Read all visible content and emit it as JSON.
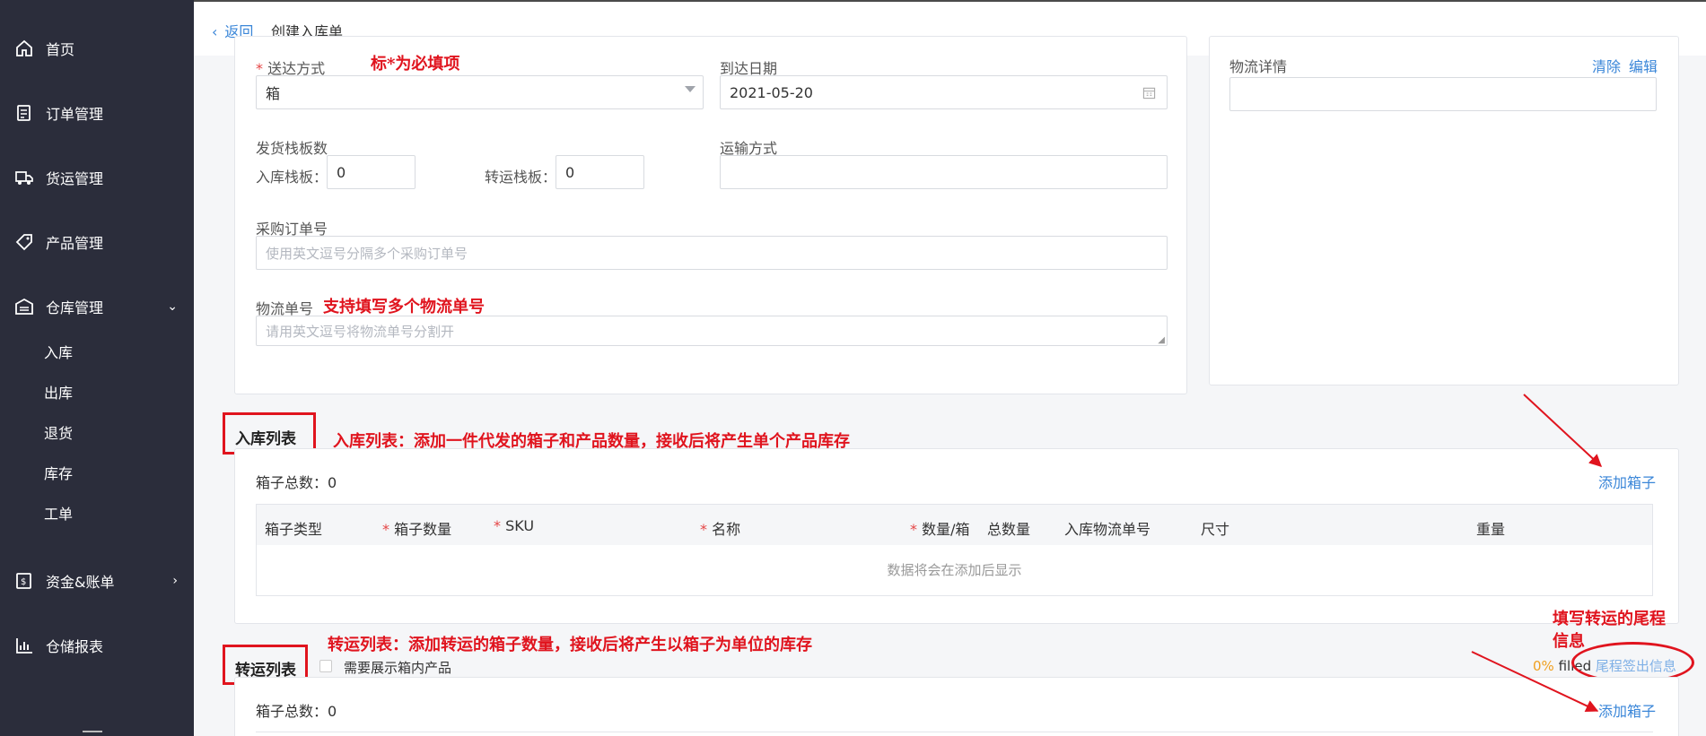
{
  "sidebar": {
    "items": [
      {
        "label": "首页",
        "icon": "home-icon"
      },
      {
        "label": "订单管理",
        "icon": "order-icon"
      },
      {
        "label": "货运管理",
        "icon": "truck-icon"
      },
      {
        "label": "产品管理",
        "icon": "tag-icon"
      },
      {
        "label": "仓库管理",
        "icon": "warehouse-icon"
      },
      {
        "label": "资金&账单",
        "icon": "bill-icon"
      },
      {
        "label": "仓储报表",
        "icon": "chart-icon"
      }
    ],
    "subitems": [
      "入库",
      "出库",
      "退货",
      "库存",
      "工单"
    ]
  },
  "header": {
    "back": "返回",
    "title": "创建入库单"
  },
  "form": {
    "delivery_label": "送达方式",
    "delivery_value": "箱",
    "arrival_label": "到达日期",
    "arrival_value": "2021-05-20",
    "pallet_label": "发货栈板数",
    "inbound_pallet_label": "入库栈板：",
    "inbound_pallet_value": "0",
    "transfer_pallet_label": "转运栈板：",
    "transfer_pallet_value": "0",
    "transport_label": "运输方式",
    "po_label": "采购订单号",
    "po_placeholder": "使用英文逗号分隔多个采购订单号",
    "tracking_label": "物流单号",
    "tracking_placeholder": "请用英文逗号将物流单号分割开"
  },
  "logistics": {
    "label": "物流详情",
    "clear": "清除",
    "edit": "编辑"
  },
  "annotations": {
    "required": "标*为必填项",
    "multi_tracking": "支持填写多个物流单号",
    "inbound_desc": "入库列表：添加一件代发的箱子和产品数量，接收后将产生单个产品库存",
    "transfer_desc": "转运列表：添加转运的箱子数量，接收后将产生以箱子为单位的库存",
    "last_mile_line1": "填写转运的尾程",
    "last_mile_line2": "信息"
  },
  "inbound": {
    "title": "入库列表",
    "box_total": "箱子总数：0",
    "add_box": "添加箱子",
    "columns": [
      "箱子类型",
      "箱子数量",
      "SKU",
      "名称",
      "数量/箱",
      "总数量",
      "入库物流单号",
      "尺寸",
      "重量"
    ],
    "empty": "数据将会在添加后显示"
  },
  "transfer": {
    "title": "转运列表",
    "show_products": "需要展示箱内产品",
    "progress": "0%",
    "progress_value": 0,
    "filled": "filled",
    "signout": "尾程签出信息",
    "box_total": "箱子总数：0",
    "add_box": "添加箱子"
  },
  "colors": {
    "sidebar": "#2b2d3b",
    "link": "#3a86d8",
    "annotation": "#e0141e",
    "required": "#e54545",
    "progress": "#f0a020"
  }
}
